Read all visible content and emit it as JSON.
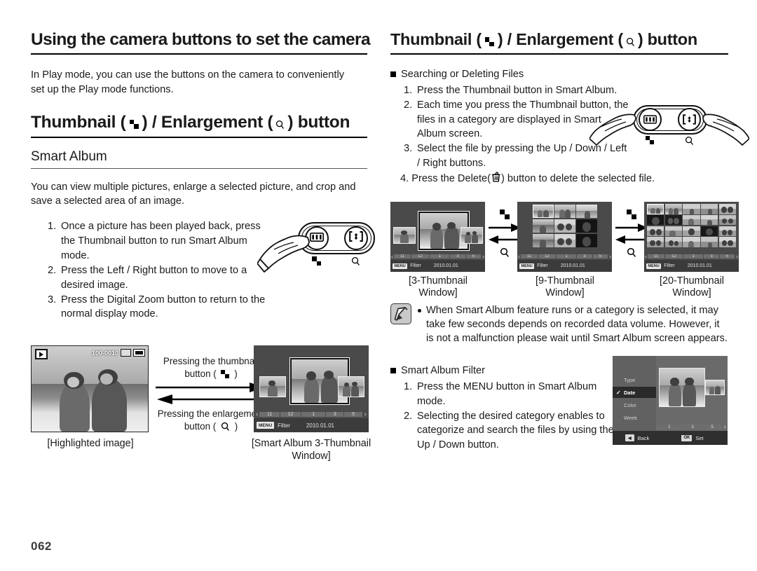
{
  "page": {
    "number": "062"
  },
  "left": {
    "title": "Using the camera buttons to set the camera",
    "intro": "In Play mode, you can use the buttons on the camera to conveniently set up the Play mode functions.",
    "section_title_before": "Thumbnail (",
    "section_title_mid": ") / Enlargement (",
    "section_title_after": ") button",
    "subsection": "Smart Album",
    "description": "You can view multiple pictures, enlarge a selected picture, and crop and save a selected area of an image.",
    "steps": [
      {
        "num": "1.",
        "text": "Once a picture has been played back, press the Thumbnail button to run Smart Album mode."
      },
      {
        "num": "2.",
        "text": "Press the Left / Right button to move to a desired image."
      },
      {
        "num": "3.",
        "text": "Press the Digital Zoom button to return to the normal display mode."
      }
    ],
    "arrow_top_line1": "Pressing the thumbnail",
    "arrow_top_line2_pre": "button (",
    "arrow_top_line2_post": ")",
    "arrow_bottom_line1": "Pressing the enlargement",
    "arrow_bottom_line2_pre": "button (",
    "arrow_bottom_line2_post": ")",
    "caption_highlighted": "[Highlighted image]",
    "caption_smartalbum": "[Smart Album 3-Thumbnail Window]",
    "lcd_overlay": {
      "file_number": "100-0010",
      "play_icon": "play-icon",
      "card_icon": "memory-card-icon",
      "battery_icon": "battery-icon"
    }
  },
  "right": {
    "title_before": "Thumbnail (",
    "title_mid": ") / Enlargement (",
    "title_after": ") button",
    "section1_heading": "Searching or Deleting Files",
    "section1_steps": [
      {
        "num": "1.",
        "text": "Press the Thumbnail button in Smart Album."
      },
      {
        "num": "2.",
        "text": "Each time you press the Thumbnail button, the files in a category are displayed in Smart Album screen."
      },
      {
        "num": "3.",
        "text": "Select the file by pressing the Up / Down / Left / Right buttons."
      }
    ],
    "step4_pre": "4. Press the Delete(",
    "step4_post": ") button to delete the selected file.",
    "window_captions": [
      "[3-Thumbnail Window]",
      "[9-Thumbnail Window]",
      "[20-Thumbnail Window]"
    ],
    "note": "When Smart Album feature runs or a category is selected, it may take few seconds depends on recorded data volume. However, it is not a malfunction please wait until Smart Album screen appears.",
    "section2_heading": "Smart Album Filter",
    "section2_steps": [
      {
        "num": "1.",
        "text": "Press the MENU button in Smart Album mode."
      },
      {
        "num": "2.",
        "text": "Selecting the desired category enables to categorize and search the files by using the Up / Down button."
      }
    ],
    "filter_menu": {
      "items": [
        "Type",
        "Date",
        "Color",
        "Week"
      ],
      "selected": "Date",
      "back_label": "Back",
      "set_label": "Set",
      "set_chip": "OK"
    }
  },
  "lcd_common": {
    "months": [
      "11",
      "12",
      "1",
      "3",
      "5"
    ],
    "menu_chip": "MENU",
    "filter_label": "Filter",
    "date": "2010.01.01",
    "left_arrow": "‹",
    "right_arrow": "›"
  },
  "colors": {
    "text": "#1a1a1a",
    "rule": "#000000",
    "lcd_bg": "#4a4a4a",
    "lcd_bar": "#3b3b3b",
    "month_cell": "#6e6e6e",
    "menu_selected": "#2a2a2a"
  }
}
